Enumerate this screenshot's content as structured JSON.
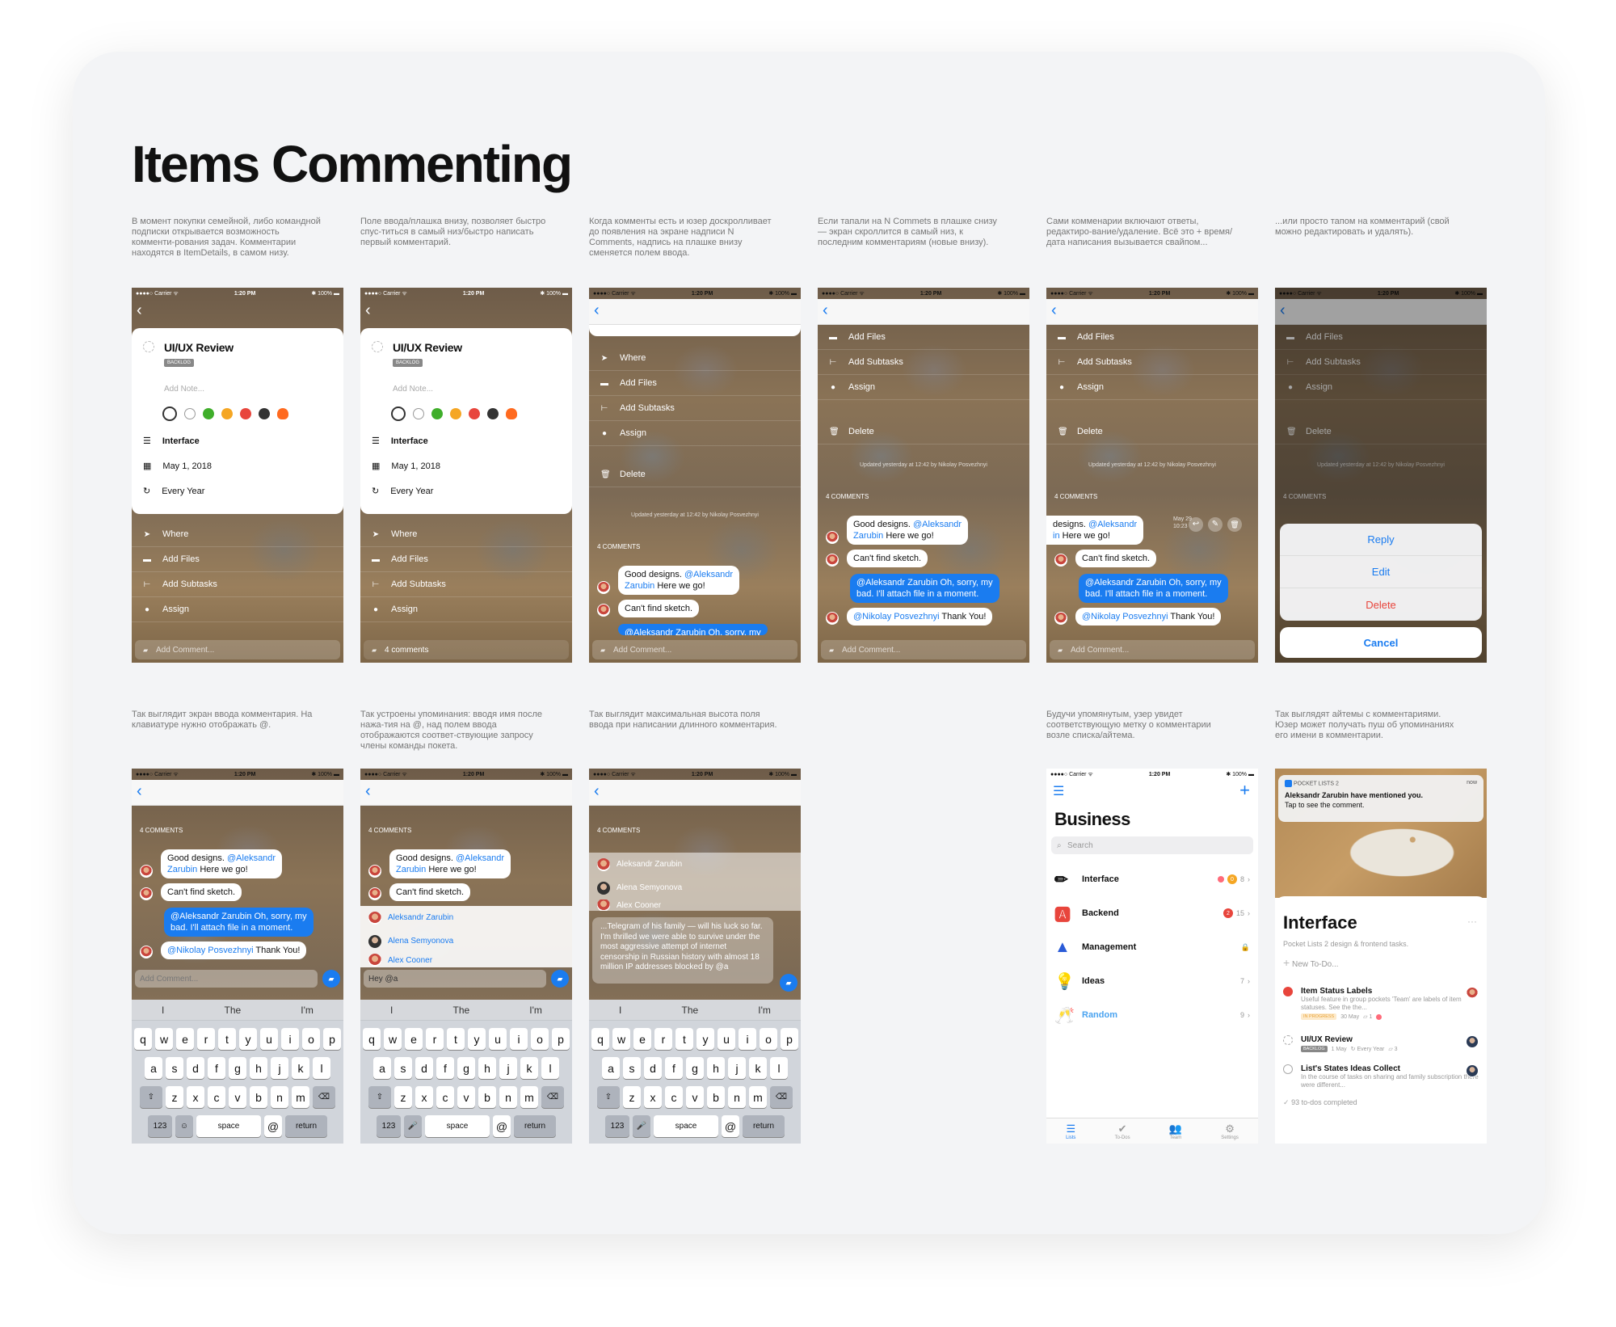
{
  "page_title": "Items Commenting",
  "descriptions_row1": [
    "В момент покупки семейной, либо командной подписки открывается возможность комменти-рования задач. Комментарии находятся в ItemDetails, в самом низу.",
    "Поле ввода/плашка внизу, позволяет быстро спус-титься в самый низ/быстро написать первый комментарий.",
    "Когда комменты есть и юзер доскролливает до появления на экране надписи N Comments, надпись на плашке внизу сменяется полем ввода.",
    "Если тапали на N Commets в плашке снизу — экран скроллится в самый низ, к последним комментариям (новые внизу).",
    "Сами комменарии включают ответы, редактиро-вание/удаление. Всё это + время/дата написания вызывается свайпом...",
    "...или просто тапом на комментарий (свой можно редактировать и удалять)."
  ],
  "descriptions_row2": [
    "Так выглядит экран ввода комментария. На клавиатуре нужно отображать @.",
    "Так устроены упоминания: вводя имя после нажа-тия на @, над полем ввода отображаются соответ-ствующие запросу члены команды покета.",
    "Так выглядит максимальная высота поля ввода при написании длинного комментария.",
    "Будучи упомянутым, узер увидет соответствующую метку о комментарии возле списка/айтема.",
    "Так выглядят айтемы с комментариями. Юзер может получать пуш об упоминаниях его имени в комментарии."
  ],
  "status": {
    "carrier": "●●●●○ Carrier ᯤ",
    "time": "1:20 PM",
    "battery": "✱ 100% ▬"
  },
  "item": {
    "title": "UI/UX Review",
    "tag": "BACKLOG",
    "note_placeholder": "Add Note...",
    "list": "Interface",
    "date": "May 1, 2018",
    "repeat": "Every Year"
  },
  "menu": {
    "where": "Where",
    "add_files": "Add Files",
    "add_subtasks": "Add Subtasks",
    "assign": "Assign",
    "delete": "Delete"
  },
  "updated": "Updated yesterday at 12:42 by Nikolay Posvezhnyi",
  "comments_count": "4 COMMENTS",
  "comments_link": "4 comments",
  "add_comment": "Add Comment...",
  "comments": {
    "c1_pre": "Good designs. ",
    "c1_mention": "@Aleksandr",
    "c1_mention2": "Zarubin",
    "c1_post": " Here we go!",
    "c2": "Can't find sketch.",
    "c3_mention": "@Aleksandr Zarubin",
    "c3_l1": " Oh, sorry, my",
    "c3_l2": "bad. I'll attach file in a moment.",
    "c4_mention": "@Nikolay Posvezhnyi",
    "c4_post": " Thank You!",
    "c1_swiped": "designs. ",
    "c1_swiped_l2": "in",
    "time_l1": "May 29",
    "time_l2": "10:23"
  },
  "actions": {
    "reply": "Reply",
    "edit": "Edit",
    "delete": "Delete",
    "cancel": "Cancel"
  },
  "keyboard": {
    "suggestions": [
      "I",
      "The",
      "I'm"
    ],
    "row1": [
      "q",
      "w",
      "e",
      "r",
      "t",
      "y",
      "u",
      "i",
      "o",
      "p"
    ],
    "row2": [
      "a",
      "s",
      "d",
      "f",
      "g",
      "h",
      "j",
      "k",
      "l"
    ],
    "row3": [
      "z",
      "x",
      "c",
      "v",
      "b",
      "n",
      "m"
    ],
    "num": "123",
    "space": "space",
    "at": "@",
    "return": "return"
  },
  "mention_input": "Hey @a",
  "mention_list": [
    "Aleksandr Zarubin",
    "Alena Semyonova",
    "Alex Cooner"
  ],
  "long_comment": "...Telegram of his family — will his luck so far. I'm thrilled we were able to survive under the most aggressive attempt of internet censorship in Russian history with almost 18 million IP addresses blocked by @a",
  "lists_screen": {
    "title": "Business",
    "search": "Search",
    "rows": [
      {
        "icon": "✏",
        "name": "Interface",
        "count": "8",
        "badge": "0"
      },
      {
        "icon": "🅰",
        "name": "Backend",
        "count": "15",
        "badge": "2"
      },
      {
        "icon": "▲",
        "name": "Management",
        "count": ""
      },
      {
        "icon": "💡",
        "name": "Ideas",
        "count": "7"
      },
      {
        "icon": "🥂",
        "name": "Random",
        "count": "9"
      }
    ],
    "tabs": [
      "Lists",
      "To-Dos",
      "Team",
      "Settings"
    ]
  },
  "interface_screen": {
    "notif_app": "POCKET LISTS 2",
    "notif_time": "now",
    "notif_title": "Aleksandr Zarubin have mentioned you.",
    "notif_body": "Tap to see the comment.",
    "title": "Interface",
    "subtitle": "Pocket Lists 2 design & frontend tasks.",
    "new_todo": "New To-Do...",
    "t1_name": "Item Status Labels",
    "t1_desc": "Useful feature in group pockets 'Team' are labels of item statuses. See the the...",
    "t1_tag": "IN PROGRESS",
    "t1_date": "30 May",
    "t1_cnt": "1",
    "t2_name": "UI/UX Review",
    "t2_tag": "BACKLOG",
    "t2_date": "1 May",
    "t2_repeat": "Every Year",
    "t2_cnt": "3",
    "t3_name": "List's States Ideas Collect",
    "t3_desc": "In the course of tasks on sharing and family subscription there were different...",
    "done": "93 to-dos completed"
  },
  "colors": {
    "accent": "#1a7cf0",
    "delete": "#e8453c",
    "board": "#f3f4f6"
  }
}
